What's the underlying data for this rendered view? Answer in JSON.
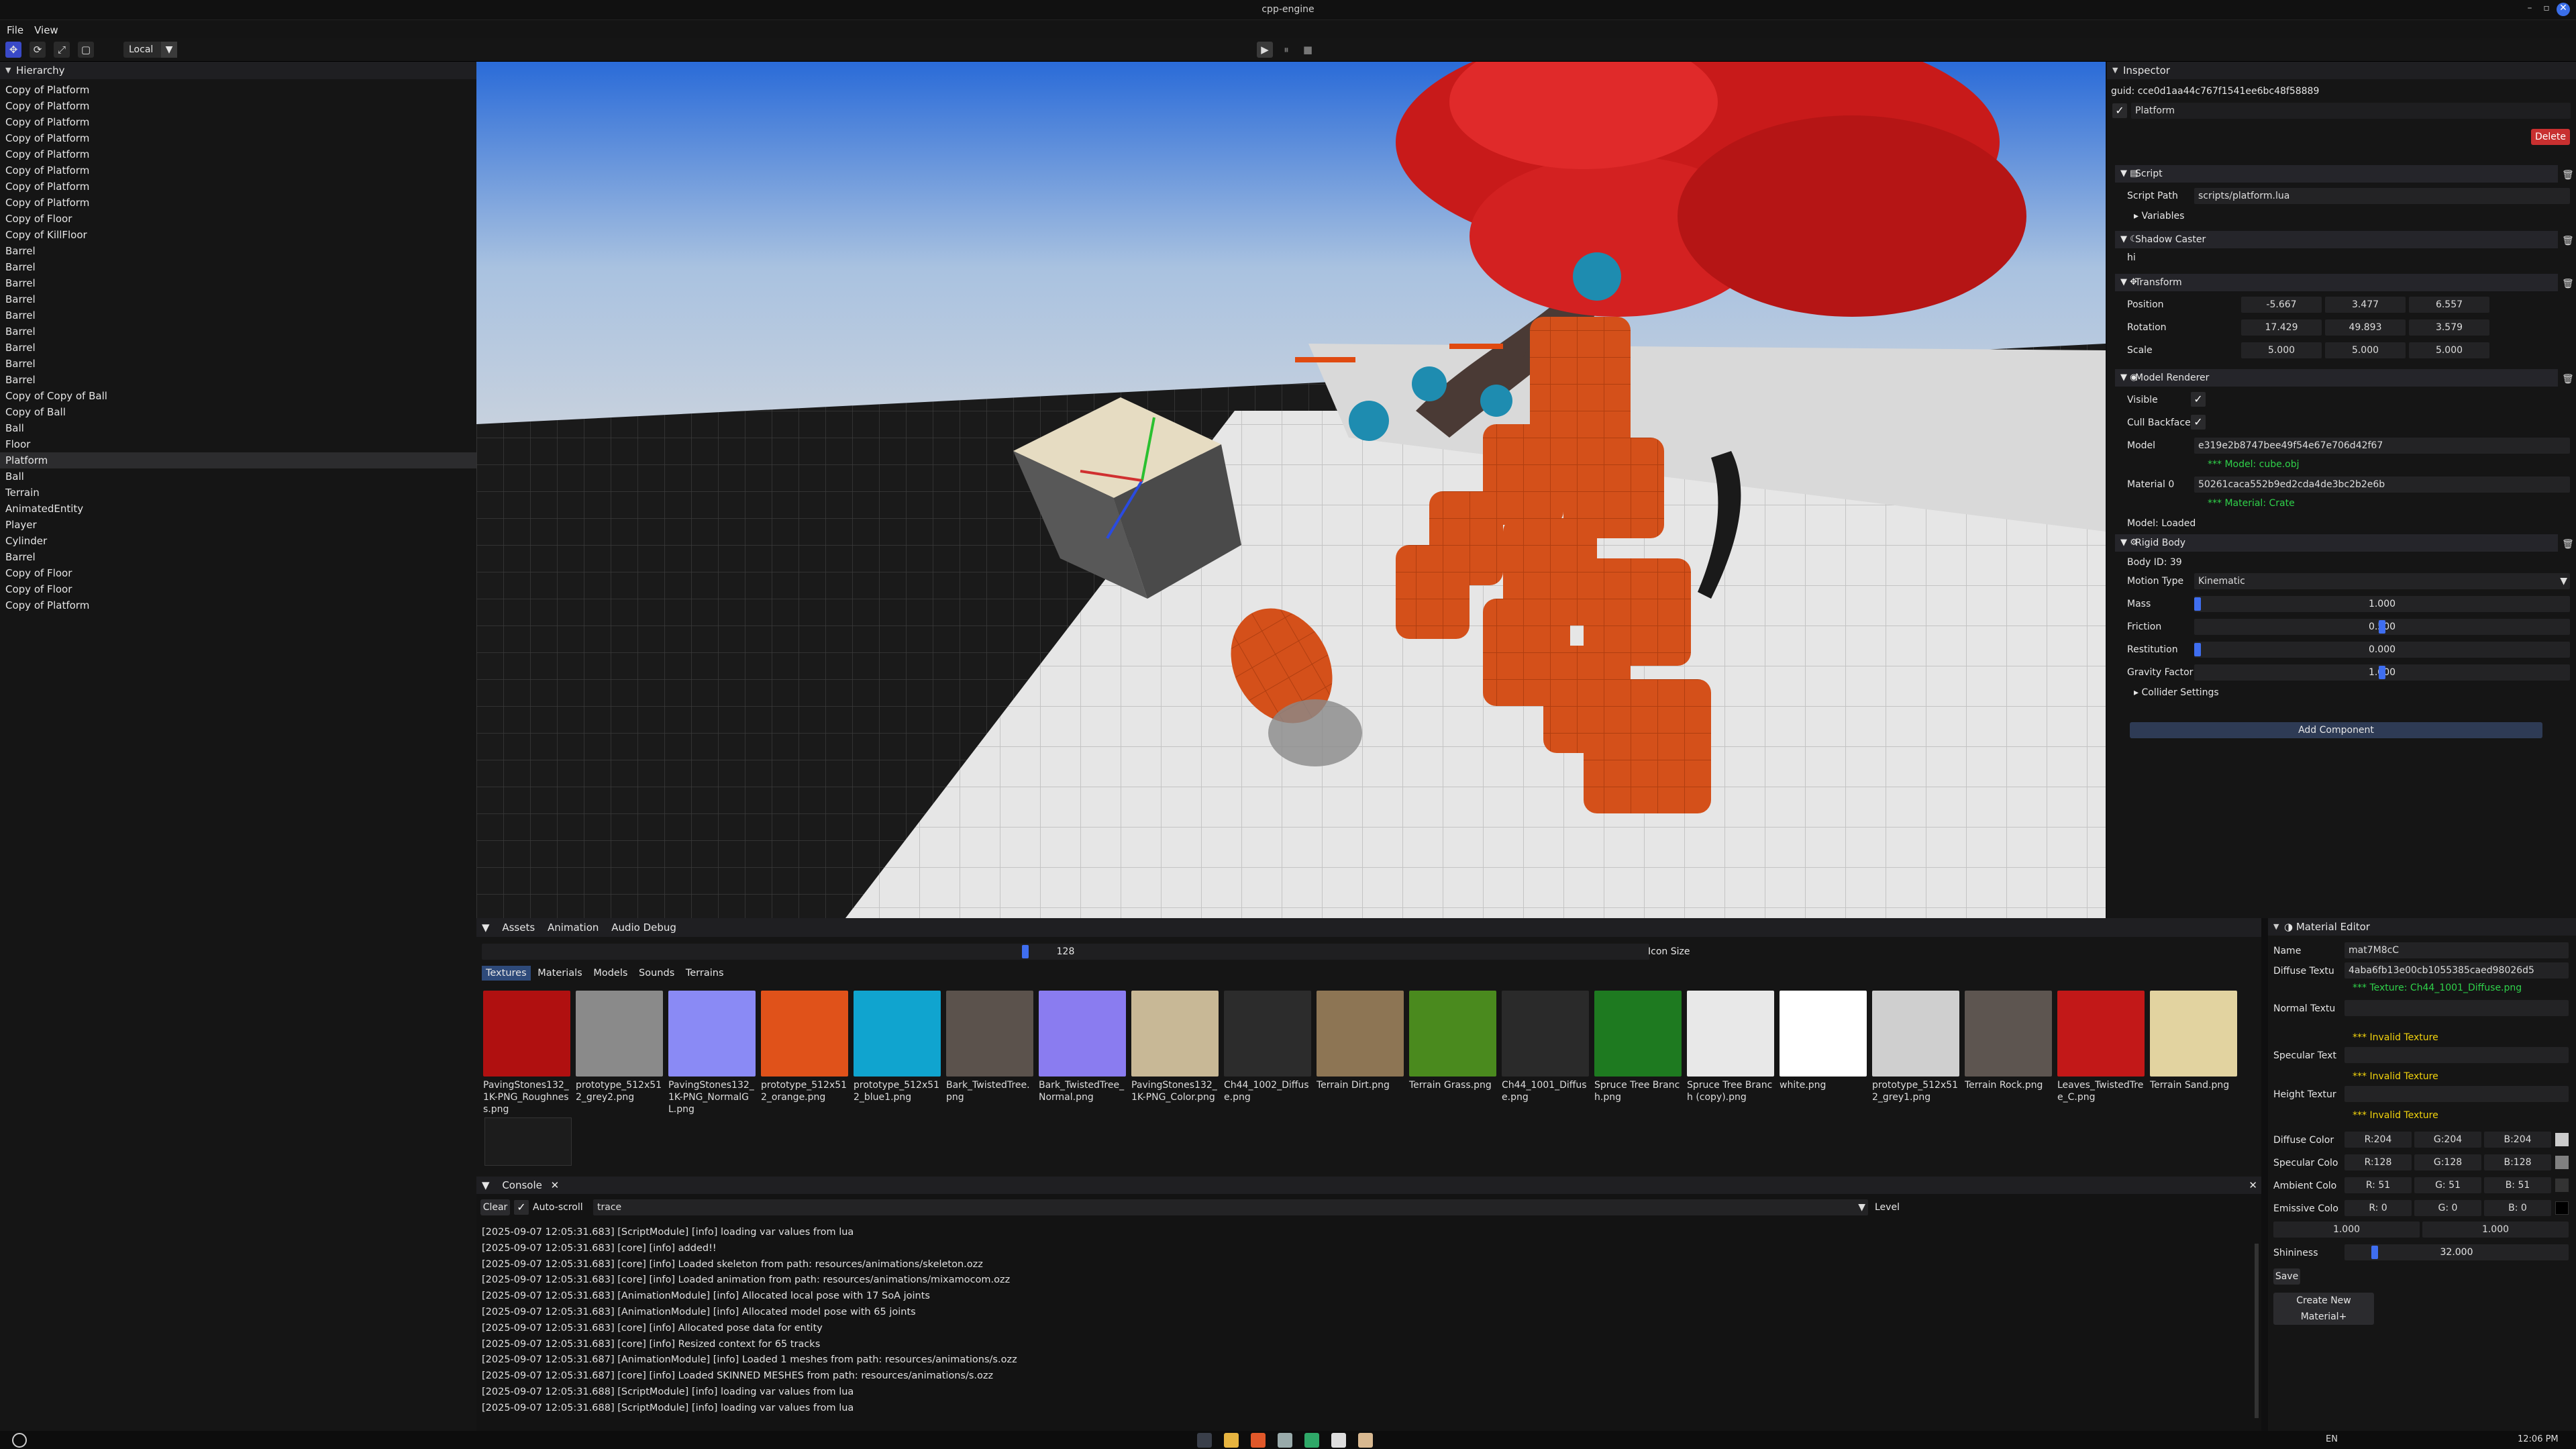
{
  "window": {
    "title": "cpp-engine"
  },
  "menu": [
    "File",
    "View"
  ],
  "toolbar": {
    "space_mode": "Local"
  },
  "hierarchy": {
    "title": "Hierarchy",
    "items": [
      "Copy of Platform",
      "Copy of Platform",
      "Copy of Platform",
      "Copy of Platform",
      "Copy of Platform",
      "Copy of Platform",
      "Copy of Platform",
      "Copy of Platform",
      "Copy of Floor",
      "Copy of KillFloor",
      "Barrel",
      "Barrel",
      "Barrel",
      "Barrel",
      "Barrel",
      "Barrel",
      "Barrel",
      "Barrel",
      "Barrel",
      "Copy of Copy of Ball",
      "Copy of Ball",
      "Ball",
      "Floor",
      "Platform",
      "Ball",
      "Terrain",
      "AnimatedEntity",
      "Player",
      "Cylinder",
      "Barrel",
      "Copy of Floor",
      "Copy of Floor",
      "Copy of Platform"
    ],
    "selected_index": 23
  },
  "inspector": {
    "title": "Inspector",
    "guid": "guid: cce0d1aa44c767f1541ee6bc48f58889",
    "entity_name": "Platform",
    "delete_label": "Delete",
    "script": {
      "title": "Script",
      "path_label": "Script Path",
      "path": "scripts/platform.lua",
      "variables": "Variables"
    },
    "shadow": {
      "title": "Shadow Caster",
      "value": "hi"
    },
    "transform": {
      "title": "Transform",
      "position_label": "Position",
      "position": [
        "-5.667",
        "3.477",
        "6.557"
      ],
      "rotation_label": "Rotation",
      "rotation": [
        "17.429",
        "49.893",
        "3.579"
      ],
      "scale_label": "Scale",
      "scale": [
        "5.000",
        "5.000",
        "5.000"
      ]
    },
    "model_renderer": {
      "title": "Model Renderer",
      "visible_label": "Visible",
      "cull_label": "Cull Backface",
      "model_label": "Model",
      "model": "e319e2b8747bee49f54e67e706d42f67",
      "model_note": "*** Model: cube.obj",
      "material_label": "Material 0",
      "material": "50261caca552b9ed2cda4de3bc2b2e6b",
      "material_note": "*** Material: Crate",
      "status": "Model: Loaded"
    },
    "rigid_body": {
      "title": "Rigid Body",
      "body_id": "Body ID: 39",
      "motion_label": "Motion Type",
      "motion": "Kinematic",
      "mass_label": "Mass",
      "mass": "1.000",
      "mass_frac": 0.0,
      "friction_label": "Friction",
      "friction": "0.500",
      "friction_frac": 0.5,
      "restitution_label": "Restitution",
      "restitution": "0.000",
      "restitution_frac": 0.0,
      "gravity_label": "Gravity Factor",
      "gravity": "1.000",
      "gravity_frac": 0.5,
      "collider": "Collider Settings"
    },
    "add_component": "Add Component"
  },
  "assets": {
    "tabs": [
      "Assets",
      "Animation",
      "Audio Debug"
    ],
    "icon_size_value": "128",
    "icon_size_label": "Icon Size",
    "subtabs": [
      "Textures",
      "Materials",
      "Models",
      "Sounds",
      "Terrains"
    ],
    "textures": [
      {
        "name": "PavingStones132_1K-PNG_Roughness.png",
        "color": "#b01010"
      },
      {
        "name": "prototype_512x512_grey2.png",
        "color": "#8a8a8a"
      },
      {
        "name": "PavingStones132_1K-PNG_NormalGL.png",
        "color": "#8a8af5"
      },
      {
        "name": "prototype_512x512_orange.png",
        "color": "#e0521a"
      },
      {
        "name": "prototype_512x512_blue1.png",
        "color": "#10a4cf"
      },
      {
        "name": "Bark_TwistedTree.png",
        "color": "#5b524c"
      },
      {
        "name": "Bark_TwistedTree_Normal.png",
        "color": "#8a7cf0"
      },
      {
        "name": "PavingStones132_1K-PNG_Color.png",
        "color": "#c8b896"
      },
      {
        "name": "Ch44_1002_Diffuse.png",
        "color": "#2c2c2c"
      },
      {
        "name": "Terrain Dirt.png",
        "color": "#8d7554"
      },
      {
        "name": "Terrain Grass.png",
        "color": "#4a8a1e"
      },
      {
        "name": "Ch44_1001_Diffuse.png",
        "color": "#2a2a2a"
      },
      {
        "name": "Spruce Tree Branch.png",
        "color": "#1e7a20"
      },
      {
        "name": "Spruce Tree Branch (copy).png",
        "color": "#e8e8e8"
      },
      {
        "name": "white.png",
        "color": "#ffffff"
      },
      {
        "name": "prototype_512x512_grey1.png",
        "color": "#cfcfcf"
      },
      {
        "name": "Terrain Rock.png",
        "color": "#5d5550"
      },
      {
        "name": "Leaves_TwistedTree_C.png",
        "color": "#c21818"
      },
      {
        "name": "Terrain Sand.png",
        "color": "#e2d3a0"
      }
    ]
  },
  "console": {
    "title": "Console",
    "clear": "Clear",
    "autoscroll": "Auto-scroll",
    "filter": "trace",
    "level": "Level",
    "lines": [
      "[2025-09-07 12:05:31.683] [ScriptModule] [info] loading var values from lua",
      "[2025-09-07 12:05:31.683] [core] [info] added!!",
      "[2025-09-07 12:05:31.683] [core] [info] Loaded skeleton from path: resources/animations/skeleton.ozz",
      "[2025-09-07 12:05:31.683] [core] [info] Loaded animation from path: resources/animations/mixamocom.ozz",
      "[2025-09-07 12:05:31.683] [AnimationModule] [info] Allocated local pose with 17 SoA joints",
      "[2025-09-07 12:05:31.683] [AnimationModule] [info] Allocated model pose with 65 joints",
      "[2025-09-07 12:05:31.683] [core] [info] Allocated pose data for entity",
      "[2025-09-07 12:05:31.683] [core] [info] Resized context for 65 tracks",
      "[2025-09-07 12:05:31.687] [AnimationModule] [info] Loaded 1 meshes from path: resources/animations/s.ozz",
      "[2025-09-07 12:05:31.687] [core] [info] Loaded SKINNED MESHES from path: resources/animations/s.ozz",
      "[2025-09-07 12:05:31.688] [ScriptModule] [info] loading var values from lua",
      "[2025-09-07 12:05:31.688] [ScriptModule] [info] loading var values from lua"
    ]
  },
  "material_editor": {
    "title": "Material Editor",
    "name_label": "Name",
    "name": "mat7M8cC",
    "diffuse_label": "Diffuse Textu",
    "diffuse": "4aba6fb13e00cb1055385caed98026d5",
    "diffuse_note": "*** Texture: Ch44_1001_Diffuse.png",
    "normal_label": "Normal Textu",
    "normal_note": "*** Invalid Texture",
    "specular_tex_label": "Specular Text",
    "specular_note": "*** Invalid Texture",
    "height_label": "Height Textur",
    "height_note": "*** Invalid Texture",
    "diffuse_color_label": "Diffuse Color",
    "diffuse_color": [
      "R:204",
      "G:204",
      "B:204"
    ],
    "diffuse_swatch": "#cccccc",
    "specular_color_label": "Specular Colo",
    "specular_color": [
      "R:128",
      "G:128",
      "B:128"
    ],
    "specular_swatch": "#808080",
    "ambient_label": "Ambient Colo",
    "ambient": [
      "R: 51",
      "G: 51",
      "B: 51"
    ],
    "ambient_swatch": "#333333",
    "emissive_label": "Emissive Colo",
    "emissive": [
      "R:  0",
      "G:  0",
      "B:  0"
    ],
    "emissive_swatch": "#000000",
    "extra": [
      "1.000",
      "1.000"
    ],
    "shininess_label": "Shininess",
    "shininess": "32.000",
    "save": "Save",
    "create": "Create New Material+"
  },
  "taskbar": {
    "language": "EN",
    "clock": "12:06 PM"
  }
}
